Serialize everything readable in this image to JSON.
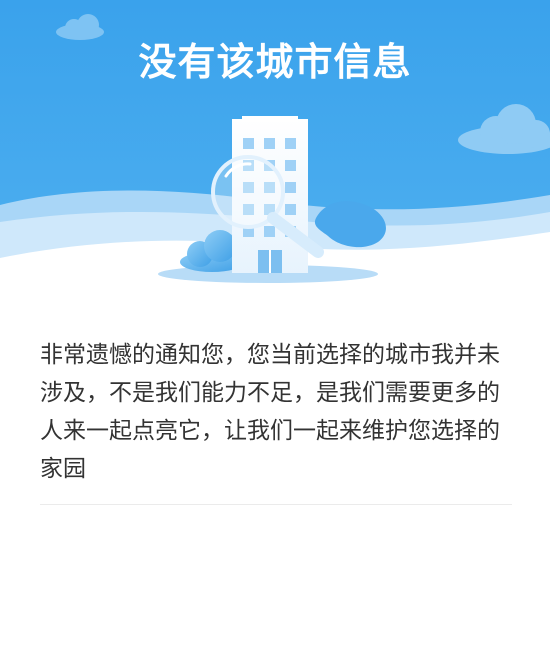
{
  "header": {
    "title": "没有该城市信息"
  },
  "illustration": {
    "icon": "building-search-icon",
    "sky_color": "#3aa0ea",
    "wave_color": "#c9e5f9"
  },
  "main": {
    "message": "非常遗憾的通知您，您当前选择的城市我并未涉及，不是我们能力不足，是我们需要更多的人来一起点亮它，让我们一起来维护您选择的家园"
  }
}
